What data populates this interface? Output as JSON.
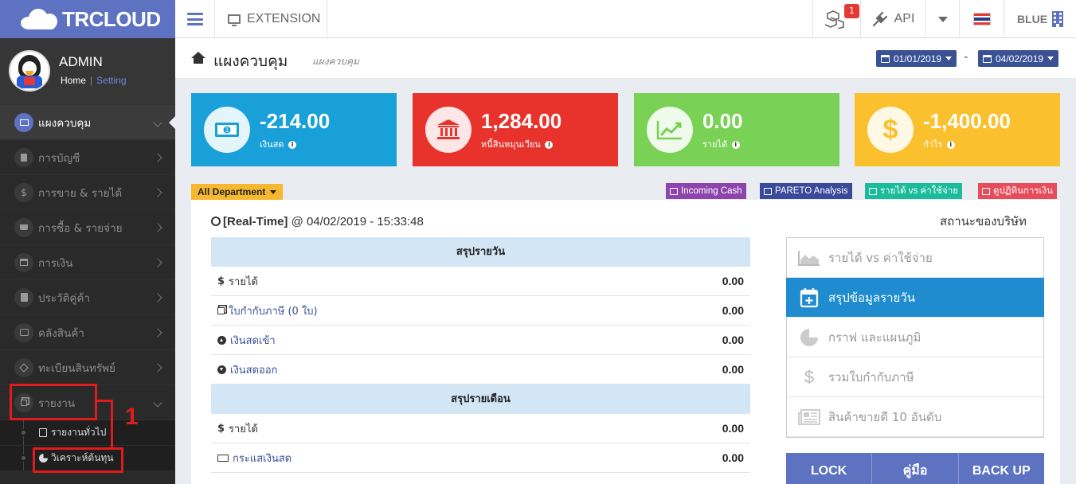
{
  "app": {
    "brand": "TRCLOUD"
  },
  "topbar": {
    "extension_label": "EXTENSION",
    "notification_count": "1",
    "api_label": "API",
    "theme_label": "BLUE"
  },
  "profile": {
    "name": "ADMIN",
    "home_link": "Home",
    "separator": "|",
    "setting_link": "Setting"
  },
  "sidebar": {
    "items": [
      {
        "label": "แผงควบคุม",
        "icon": "monitor-icon"
      },
      {
        "label": "การบัญชี",
        "icon": "book-icon"
      },
      {
        "label": "การขาย & รายได้",
        "icon": "dollar-icon"
      },
      {
        "label": "การซื้อ & รายจ่าย",
        "icon": "cart-icon"
      },
      {
        "label": "การเงิน",
        "icon": "calendar-icon"
      },
      {
        "label": "ประวัติคู่ค้า",
        "icon": "contact-icon"
      },
      {
        "label": "คลังสินค้า",
        "icon": "cubes-icon"
      },
      {
        "label": "ทะเบียนสินทรัพย์",
        "icon": "diamond-icon"
      },
      {
        "label": "รายงาน",
        "icon": "copy-icon"
      }
    ],
    "sub_items": [
      {
        "label": "รายงานทั่วไป",
        "icon": "document-icon"
      },
      {
        "label": "วิเคราะห์ต้นทุน",
        "icon": "pie-chart-icon"
      }
    ],
    "annotation_number": "1",
    "annotation_color": "#e01b1b"
  },
  "page": {
    "title": "แผงควบคุม",
    "subtitle": "แผงควบคุม",
    "date_from": "01/01/2019",
    "date_separator": "-",
    "date_to": "04/02/2019"
  },
  "stats": [
    {
      "value": "-214.00",
      "label": "เงินสด",
      "color": "#1aa0d8",
      "icon": "money-icon"
    },
    {
      "value": "1,284.00",
      "label": "หนี้สินหมุนเวียน",
      "color": "#e8322c",
      "icon": "bank-icon"
    },
    {
      "value": "0.00",
      "label": "รายได้",
      "color": "#79d155",
      "icon": "line-chart-icon"
    },
    {
      "value": "-1,400.00",
      "label": "กำไร",
      "color": "#fbc02d",
      "icon": "dollar-icon"
    }
  ],
  "filters": {
    "department": "All Department",
    "tags": [
      {
        "label": "Incoming Cash",
        "color": "#8e44ad"
      },
      {
        "label": "PARETO Analysis",
        "color": "#3a4a9a"
      },
      {
        "label": "รายได้ vs ค่าใช้จ่าย",
        "color": "#1abc9c"
      },
      {
        "label": "ดูปฏิทินการเงิน",
        "color": "#e74c5a"
      }
    ]
  },
  "realtime": {
    "label": "[Real-Time]",
    "timestamp": "@ 04/02/2019 - 15:33:48"
  },
  "daily": {
    "header": "สรุปรายวัน",
    "rows": [
      {
        "label": "รายได้",
        "value": "0.00"
      },
      {
        "label": "ใบกำกับภาษี (0 ใบ)",
        "value": "0.00"
      },
      {
        "label": "เงินสดเข้า",
        "value": "0.00"
      },
      {
        "label": "เงินสดออก",
        "value": "0.00"
      }
    ]
  },
  "monthly": {
    "header": "สรุปรายเดือน",
    "rows": [
      {
        "label": "รายได้",
        "value": "0.00"
      },
      {
        "label": "กระแสเงินสด",
        "value": "0.00"
      }
    ]
  },
  "company_status": {
    "title": "สถานะของบริษัท",
    "items": [
      {
        "label": "รายได้ vs ค่าใช้จ่าย",
        "icon": "area-chart-icon"
      },
      {
        "label": "สรุปข้อมูลรายวัน",
        "icon": "calendar-plus-icon"
      },
      {
        "label": "กราฟ และแผนภูมิ",
        "icon": "pie-chart-icon"
      },
      {
        "label": "รวมใบกำกับภาษี",
        "icon": "dollar-icon"
      },
      {
        "label": "สินค้าขายดี 10 อันดับ",
        "icon": "newspaper-icon"
      }
    ]
  },
  "actions": {
    "lock": "LOCK",
    "manual": "คู่มือ",
    "backup": "BACK UP"
  }
}
